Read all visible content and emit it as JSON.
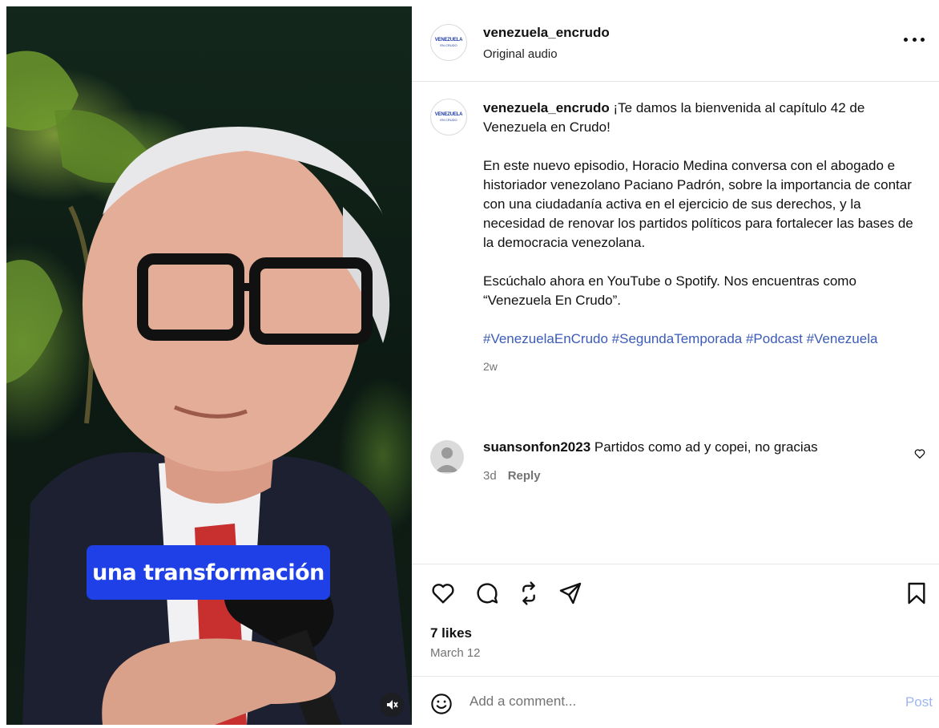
{
  "media": {
    "caption_overlay": "una transformación",
    "mute_icon": "speaker-muted-icon"
  },
  "header": {
    "username": "venezuela_encrudo",
    "subtitle": "Original audio",
    "avatar_logo_text": "VENEZUELA",
    "avatar_logo_sub": "EN CRUDO",
    "more_icon": "more-horizontal-icon"
  },
  "caption": {
    "username": "venezuela_encrudo",
    "paragraph_1": "¡Te damos la bienvenida al capítulo 42 de Venezuela en Crudo!",
    "paragraph_2": "En este nuevo episodio, Horacio Medina conversa con el abogado e historiador venezolano Paciano Padrón, sobre la importancia de contar con una ciudadanía activa en el ejercicio de sus derechos, y la necesidad de renovar los partidos políticos para fortalecer las bases de la democracia venezolana.",
    "paragraph_3": "Escúchalo ahora en YouTube o Spotify. Nos encuentras como “Venezuela En Crudo”.",
    "hashtags": "#VenezuelaEnCrudo #SegundaTemporada #Podcast #Venezuela",
    "time_ago": "2w"
  },
  "comments": [
    {
      "username": "suansonfon2023",
      "text": "Partidos como ad y copei, no gracias",
      "time_ago": "3d",
      "reply_label": "Reply"
    }
  ],
  "actions": {
    "icons": [
      "heart-icon",
      "comment-icon",
      "repost-icon",
      "share-icon",
      "bookmark-icon"
    ],
    "likes": "7 likes",
    "date": "March 12"
  },
  "add_comment": {
    "placeholder": "Add a comment...",
    "post_label": "Post"
  },
  "colors": {
    "caption_chip": "#1e40e6",
    "hashtag": "#3b5bb8",
    "post_button": "#9fb6f0",
    "muted_text": "#737373"
  }
}
